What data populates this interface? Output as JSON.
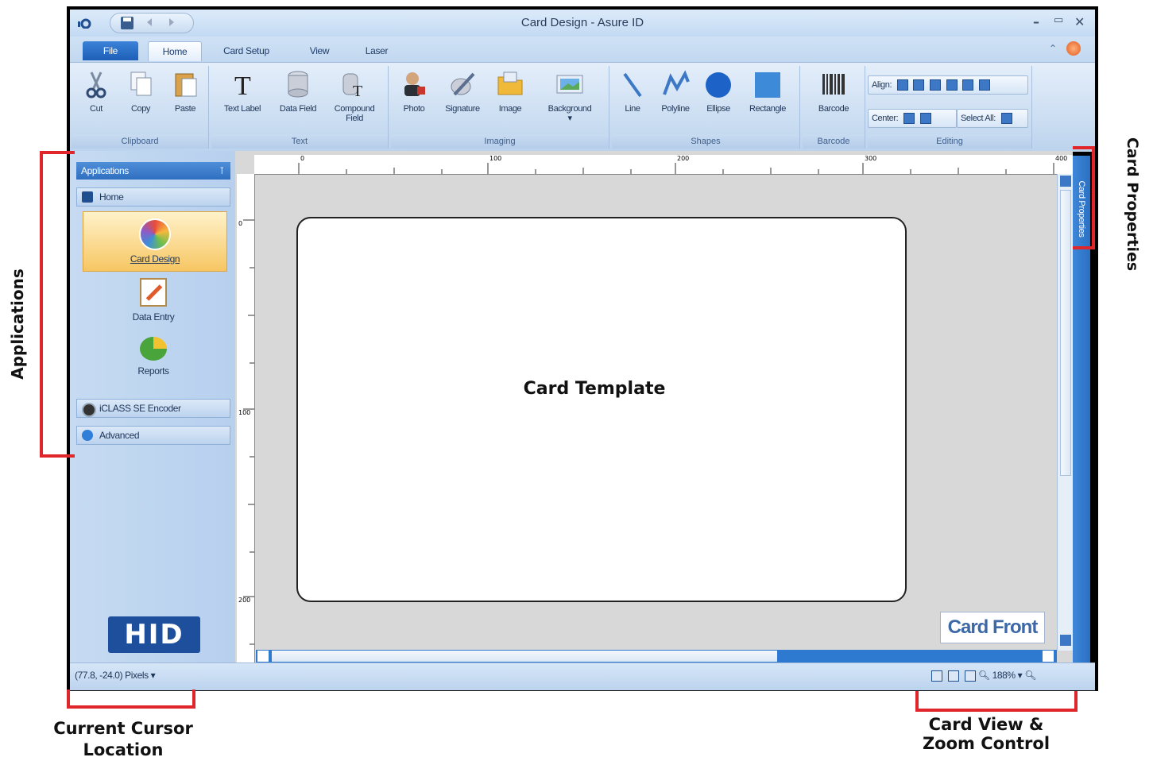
{
  "window": {
    "title": "Card Design - Asure ID",
    "app_icon": "asure-id-icon",
    "controls": [
      "–",
      "▭",
      "✕"
    ]
  },
  "quick_access": [
    "save-icon",
    "undo-icon",
    "redo-icon"
  ],
  "tabs": [
    "File",
    "Home",
    "Card Setup",
    "View",
    "Laser"
  ],
  "ribbon": {
    "clipboard": {
      "label": "Clipboard",
      "buttons": [
        "Cut",
        "Copy",
        "Paste"
      ]
    },
    "text": {
      "label": "Text",
      "buttons": [
        "Text Label",
        "Data Field",
        "Compound",
        "Field"
      ]
    },
    "imaging": {
      "label": "Imaging",
      "buttons": [
        "Photo",
        "Signature",
        "Image",
        "Background"
      ]
    },
    "shapes": {
      "label": "Shapes",
      "buttons": [
        "Line",
        "Polyline",
        "Ellipse",
        "Rectangle"
      ]
    },
    "barcode": {
      "label": "Barcode",
      "buttons": [
        "Barcode"
      ]
    },
    "editing": {
      "label": "Editing",
      "align": "Align:",
      "center": "Center:",
      "select_all": "Select All:"
    }
  },
  "left_panel": {
    "header": "Applications",
    "home": "Home",
    "apps": [
      "Card Design",
      "Data Entry",
      "Reports"
    ],
    "iclass": "iCLASS SE Encoder",
    "advanced": "Advanced",
    "logo": "HID"
  },
  "ruler": {
    "h_ticks": [
      "0",
      "100",
      "200",
      "300",
      "400"
    ],
    "v_ticks": [
      "0",
      "100",
      "200"
    ]
  },
  "canvas": {
    "card_front": "Card Front",
    "card_template": "Card Template"
  },
  "side_tab": "Card Properties",
  "status": {
    "coords": "(77.8, -24.0) Pixels",
    "zoom": "188%"
  },
  "annotations": {
    "applications": "Applications",
    "card_properties": "Card Properties",
    "cursor_location": [
      "Current Cursor",
      "Location"
    ],
    "card_view": [
      "Card View &",
      "Zoom Control"
    ]
  },
  "colors": {
    "accent_red": "#e0262b",
    "ribbon_blue": "#c9dcf1",
    "file_tab": "#1e5fb8"
  }
}
